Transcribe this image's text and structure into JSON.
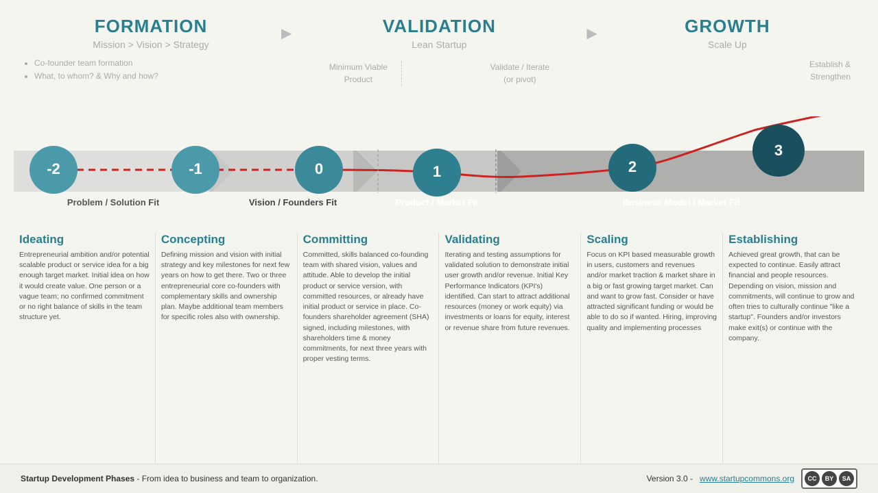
{
  "header": {
    "formation": {
      "title": "FORMATION",
      "subtitle": "Mission  >  Vision  >  Strategy",
      "bullets": [
        "Co-founder team formation",
        "What, to whom? & Why and how?"
      ]
    },
    "validation": {
      "title": "VALIDATION",
      "subtitle": "Lean Startup",
      "sub1": "Minimum Viable\nProduct",
      "sub2": "Validate / Iterate\n(or pivot)"
    },
    "growth": {
      "title": "GROWTH",
      "subtitle": "Scale Up",
      "sub1": "Establish &\nStrengthen"
    }
  },
  "stages": {
    "circles": [
      "-2",
      "-1",
      "0",
      "1",
      "2",
      "3"
    ],
    "labels": [
      "Problem / Solution Fit",
      "Vision / Founders Fit",
      "Product / Market Fit",
      "Business Model / Market Fit"
    ]
  },
  "columns": [
    {
      "title": "Ideating",
      "text": "Entrepreneurial ambition and/or potential scalable product or service idea for a big enough target market. Initial idea on how it would create value. One person or a vague team; no confirmed commitment or no right balance of skills in the team structure yet."
    },
    {
      "title": "Concepting",
      "text": "Defining mission and vision with initial strategy and key milestones for next few years on how to get there. Two or three entrepreneurial core co-founders with complementary skills and ownership plan. Maybe additional team members for specific roles also with ownership."
    },
    {
      "title": "Committing",
      "text": "Committed, skills balanced co-founding team with shared vision, values and attitude. Able to develop the initial product or service version, with committed resources, or already have initial product or service in place. Co-founders shareholder agreement (SHA) signed, including milestones, with shareholders time & money commitments, for next three years with proper vesting terms."
    },
    {
      "title": "Validating",
      "text": "Iterating and testing assumptions for validated solution to demonstrate initial user growth and/or revenue. Initial Key Performance Indicators (KPI's) identified. Can start to attract additional resources (money or work equity) via investments or loans for equity, interest or revenue share from future revenues."
    },
    {
      "title": "Scaling",
      "text": "Focus on KPI based measurable growth in users, customers and revenues and/or market traction & market share in a big or fast growing target market. Can and want to grow fast. Consider or have attracted significant funding or would be able to do so if wanted. Hiring, improving quality and implementing processes"
    },
    {
      "title": "Establishing",
      "text": "Achieved great growth, that can be expected to continue. Easily attract financial and people resources. Depending on vision, mission and commitments, will continue to grow and often tries to culturally continue \"like a startup\". Founders and/or investors make exit(s) or continue with the company."
    }
  ],
  "footer": {
    "left_bold": "Startup Development Phases",
    "left_rest": " - From idea to business and team to organization.",
    "right_text": "Version 3.0  -  ",
    "link": "www.startupcommons.org"
  }
}
